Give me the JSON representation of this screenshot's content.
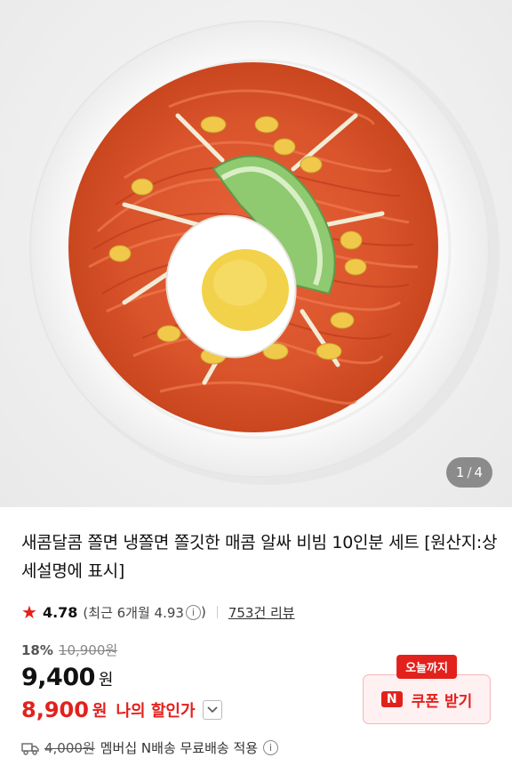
{
  "gallery": {
    "image_alt": "비빔쫄면 이미지",
    "current": "1",
    "separator": "/",
    "total": "4"
  },
  "product": {
    "title": "새콤달콤 쫄면 냉쫄면 쫄깃한 매콤 알싸 비빔 10인분 세트 [원산지:상세설명에 표시]"
  },
  "rating": {
    "score": "4.78",
    "recent_prefix": "(최근 6개월 4.93",
    "recent_suffix": ")",
    "review_link": "753건 리뷰",
    "star_color": "#e2211c"
  },
  "pricing": {
    "discount_rate": "18%",
    "original_price": "10,900원",
    "price": "9,400",
    "price_unit": "원",
    "my_price": "8,900",
    "my_price_unit": "원",
    "my_price_label": "나의 할인가",
    "accent_color": "#e2211c"
  },
  "coupon": {
    "badge": "오늘까지",
    "logo": "N",
    "label": "쿠폰 받기"
  },
  "shipping": {
    "original_fee": "4,000원",
    "text": "멤버십 N배송 무료배송 적용"
  },
  "icons": {
    "star": "star-icon",
    "info": "info-icon",
    "chevron": "chevron-down-icon",
    "truck": "truck-icon"
  }
}
